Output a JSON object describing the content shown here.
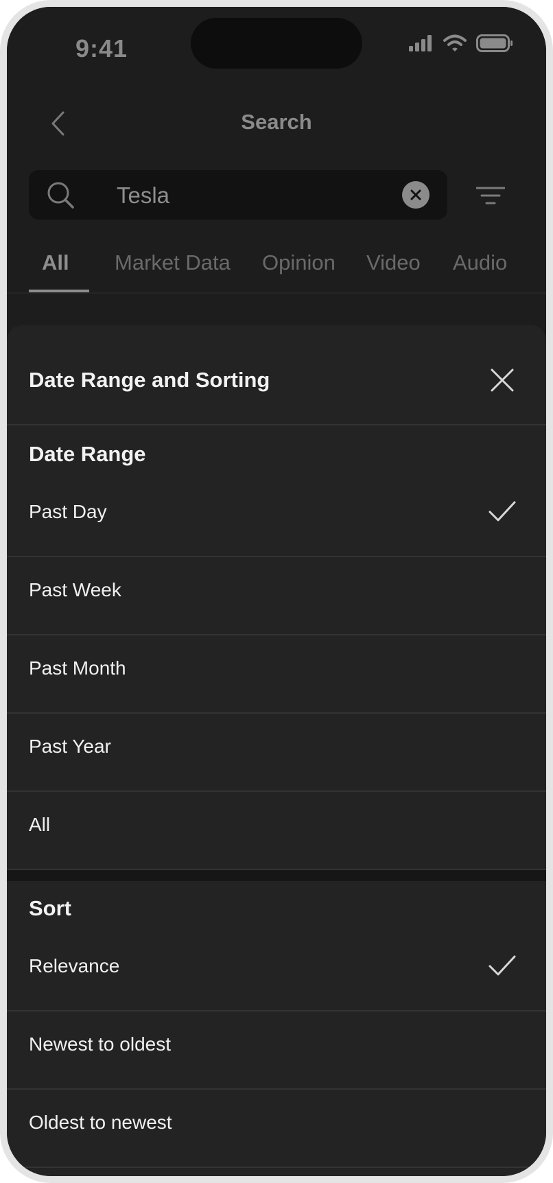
{
  "status_bar": {
    "time": "9:41"
  },
  "header": {
    "title": "Search"
  },
  "search": {
    "query": "Tesla"
  },
  "tabs": [
    {
      "label": "All",
      "active": true
    },
    {
      "label": "Market Data",
      "active": false
    },
    {
      "label": "Opinion",
      "active": false
    },
    {
      "label": "Video",
      "active": false
    },
    {
      "label": "Audio",
      "active": false
    }
  ],
  "sheet": {
    "title": "Date Range and Sorting",
    "date_range": {
      "title": "Date Range",
      "options": [
        {
          "label": "Past Day",
          "selected": true
        },
        {
          "label": "Past Week",
          "selected": false
        },
        {
          "label": "Past Month",
          "selected": false
        },
        {
          "label": "Past Year",
          "selected": false
        },
        {
          "label": "All",
          "selected": false
        }
      ]
    },
    "sort": {
      "title": "Sort",
      "options": [
        {
          "label": "Relevance",
          "selected": true
        },
        {
          "label": "Newest to oldest",
          "selected": false
        },
        {
          "label": "Oldest to newest",
          "selected": false
        }
      ]
    }
  },
  "colors": {
    "background": "#1b1b1b",
    "sheet": "#232323",
    "text_primary": "#f0f0f0",
    "text_muted": "#8e8e8e"
  }
}
